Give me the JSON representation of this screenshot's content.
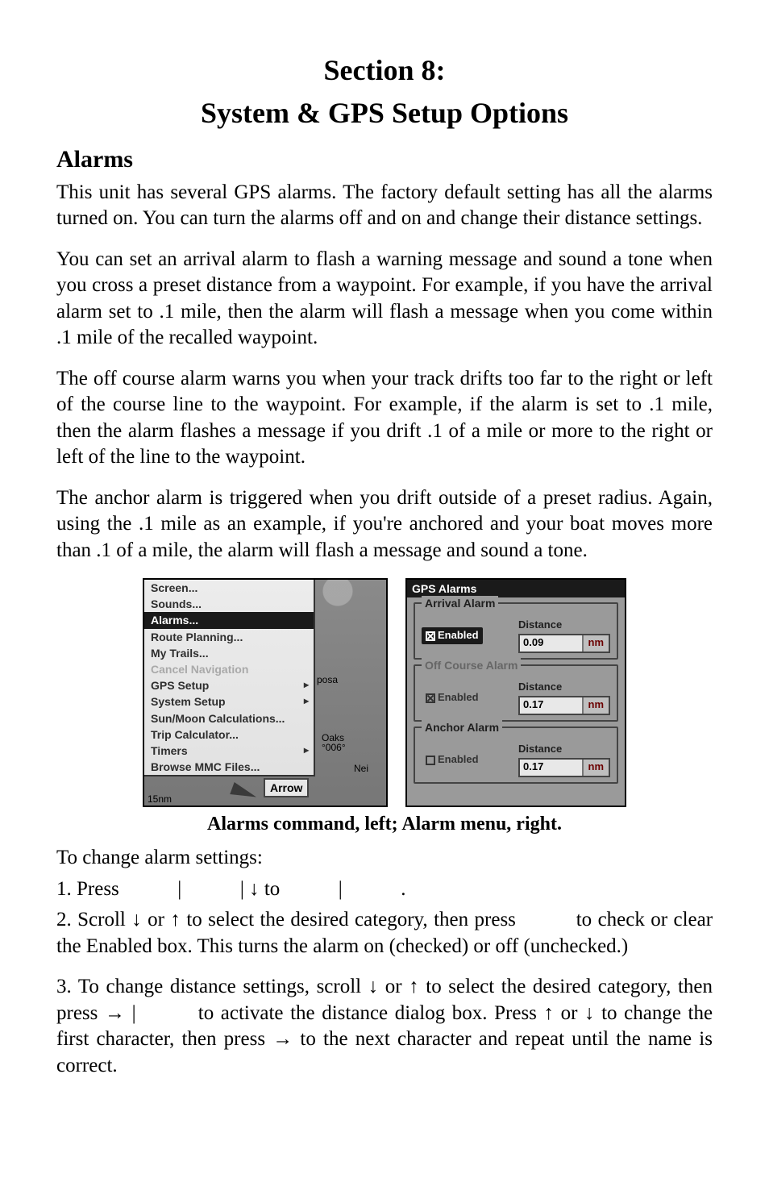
{
  "title1": "Section 8:",
  "title2": "System & GPS Setup Options",
  "h2": "Alarms",
  "p1": "This unit has several GPS alarms. The factory default setting has all the alarms turned on. You can turn the alarms off and on and change their distance settings.",
  "p2": "You can set an arrival alarm to flash a warning message and sound a tone when you cross a preset distance from a waypoint. For example, if you have the arrival alarm set to .1 mile, then the alarm will flash a message when you come within .1 mile of the recalled waypoint.",
  "p3": "The off course alarm warns you when your track drifts too far to the right or left of the course line to the waypoint. For example, if the alarm is set to .1 mile, then the alarm flashes a message if you drift .1 of a mile or more to the right or left of the line to the waypoint.",
  "p4": "The anchor alarm is triggered when you drift outside of a preset radius. Again, using the .1 mile as an example, if you're anchored and your boat moves more than .1 of a mile, the alarm will flash a message and sound a tone.",
  "menu": {
    "items": [
      "Screen...",
      "Sounds...",
      "Alarms...",
      "Route Planning...",
      "My Trails...",
      "Cancel Navigation",
      "GPS Setup",
      "System Setup",
      "Sun/Moon Calculations...",
      "Trip Calculator...",
      "Timers",
      "Browse MMC Files..."
    ],
    "map_labels": {
      "posa": "posa",
      "oaks": "Oaks",
      "code": "°006°",
      "nei": "Nei"
    },
    "arrow_label": "Arrow",
    "scale": "15nm"
  },
  "alarms_panel": {
    "title": "GPS Alarms",
    "groups": [
      {
        "legend": "Arrival Alarm",
        "enabled_label": "Enabled",
        "checked": true,
        "selected": true,
        "dist_label": "Distance",
        "value": "0.09",
        "unit": "nm"
      },
      {
        "legend": "Off Course Alarm",
        "enabled_label": "Enabled",
        "checked": true,
        "selected": false,
        "dist_label": "Distance",
        "value": "0.17",
        "unit": "nm"
      },
      {
        "legend": "Anchor Alarm",
        "enabled_label": "Enabled",
        "checked": false,
        "selected": false,
        "dist_label": "Distance",
        "value": "0.17",
        "unit": "nm"
      }
    ]
  },
  "caption": "Alarms command, left; Alarm menu, right.",
  "steps_intro": "To change alarm settings:",
  "step1_a": "1. Press ",
  "step1_b": " to ",
  "step1_c": ".",
  "step2_a": "2. Scroll ",
  "step2_b": " or ",
  "step2_c": " to select the desired category, then press ",
  "step2_d": " to check or clear the Enabled box. This turns the alarm on (checked) or off (unchecked.)",
  "step3_a": "3. To change distance settings, scroll ",
  "step3_b": " or ",
  "step3_c": " to select the desired category, then press ",
  "step3_d": " to activate the distance dialog box. Press ",
  "step3_e": " or ",
  "step3_f": " to change the first character, then press ",
  "step3_g": " to the next character and repeat until the name is correct.",
  "sym": {
    "up": "↑",
    "down": "↓",
    "right": "→",
    "bar": "|"
  }
}
